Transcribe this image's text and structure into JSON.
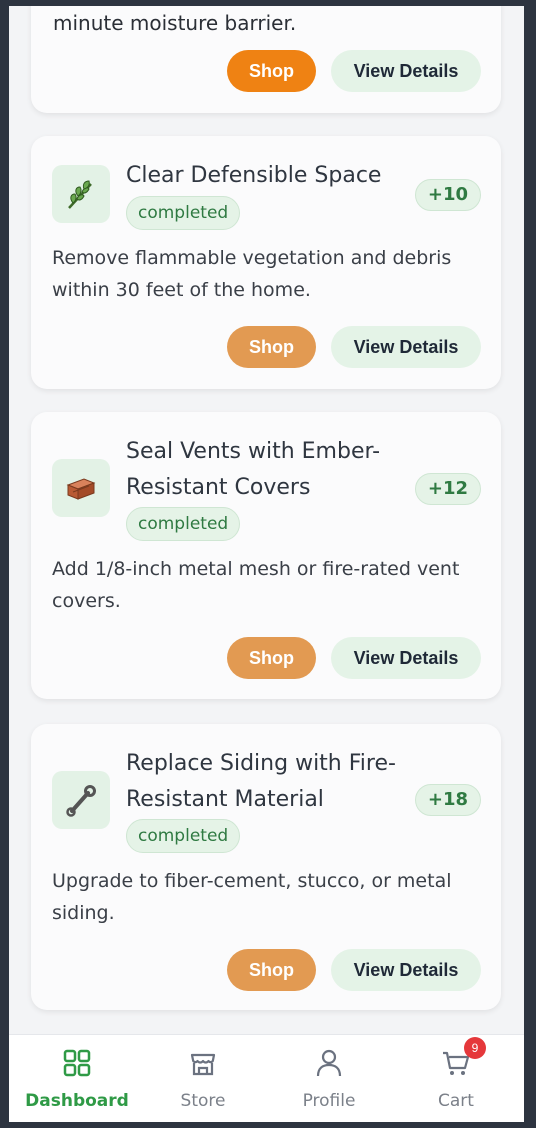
{
  "top_card": {
    "partial_description": "minute moisture barrier.",
    "shop_label": "Shop",
    "details_label": "View Details"
  },
  "cards": [
    {
      "icon": "leaf-icon",
      "title": "Clear Defensible Space",
      "status": "completed",
      "points": "+10",
      "description": "Remove flammable vegetation and debris within 30 feet of the home.",
      "shop_label": "Shop",
      "details_label": "View Details"
    },
    {
      "icon": "brick-icon",
      "title": "Seal Vents with Ember-Resistant Covers",
      "status": "completed",
      "points": "+12",
      "description": "Add 1/8-inch metal mesh or fire-rated vent covers.",
      "shop_label": "Shop",
      "details_label": "View Details"
    },
    {
      "icon": "wrench-icon",
      "title": "Replace Siding with Fire-Resistant Material",
      "status": "completed",
      "points": "+18",
      "description": "Upgrade to fiber-cement, stucco, or metal siding.",
      "shop_label": "Shop",
      "details_label": "View Details"
    }
  ],
  "nav": {
    "items": [
      {
        "label": "Dashboard",
        "icon": "grid-icon",
        "active": true
      },
      {
        "label": "Store",
        "icon": "store-icon"
      },
      {
        "label": "Profile",
        "icon": "user-icon"
      },
      {
        "label": "Cart",
        "icon": "cart-icon",
        "badge": "9"
      }
    ]
  },
  "colors": {
    "accent_green": "#2f9a46",
    "shop_orange": "#ef8213",
    "shop_orange_muted": "#e29a52",
    "badge_red": "#e5383b"
  }
}
